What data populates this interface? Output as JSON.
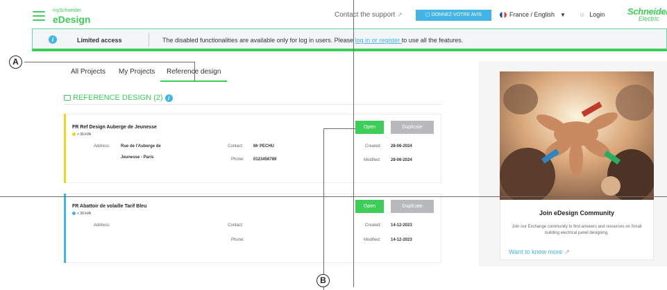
{
  "header": {
    "brand_small": "mySchneider",
    "brand": "eDesign",
    "support": "Contact the support",
    "feedback": "DONNEZ VOTRE AVIS",
    "language": "France / English",
    "login": "Login",
    "logo_main": "Schneider",
    "logo_sub": "Electric"
  },
  "banner": {
    "title": "Limited access",
    "message_pre": "The disabled functionalities are available only for log in users. Please ",
    "message_link": "log in or register ",
    "message_post": "to use all the features."
  },
  "tabs": [
    {
      "label": "All Projects"
    },
    {
      "label": "My Projects"
    },
    {
      "label": "Reference design"
    }
  ],
  "section": {
    "title": "REFERENCE DESIGN (2)"
  },
  "projects": [
    {
      "title": "FR Ref Design Auberge de Jeunesse",
      "tag": "> 36 kVA",
      "accent": "#f6d21e",
      "address_label": "Address:",
      "address_line1": "Rue de l'Auberge de",
      "address_line2": "Jeunesse - Paris",
      "contact_label": "Contact:",
      "contact": "Mr PECHU",
      "phone_label": "Phone:",
      "phone": "0123456789",
      "created_label": "Created:",
      "created": "28-06-2024",
      "modified_label": "Modified:",
      "modified": "28-06-2024",
      "open": "Open",
      "duplicate": "Duplicate"
    },
    {
      "title": "FR Abattoir de volaille Tarif Bleu",
      "tag": "< 36 kVA",
      "accent": "#42b4e6",
      "address_label": "Address:",
      "address_line1": "",
      "address_line2": "",
      "contact_label": "Contact:",
      "contact": "",
      "phone_label": "Phone:",
      "phone": "",
      "created_label": "Created:",
      "created": "14-12-2023",
      "modified_label": "Modified:",
      "modified": "14-12-2023",
      "open": "Open",
      "duplicate": "Duplicate"
    }
  ],
  "community": {
    "title": "Join eDesign Community",
    "text": "Join our Exchange community to find answers and resources on Small building electrical panel designing.",
    "link": "Want to know more"
  },
  "callouts": {
    "a": "A",
    "b": "B"
  },
  "colors": {
    "brand_green": "#3dcd58",
    "info_blue": "#42b4e6",
    "disabled_gray": "#b8b9bc"
  }
}
